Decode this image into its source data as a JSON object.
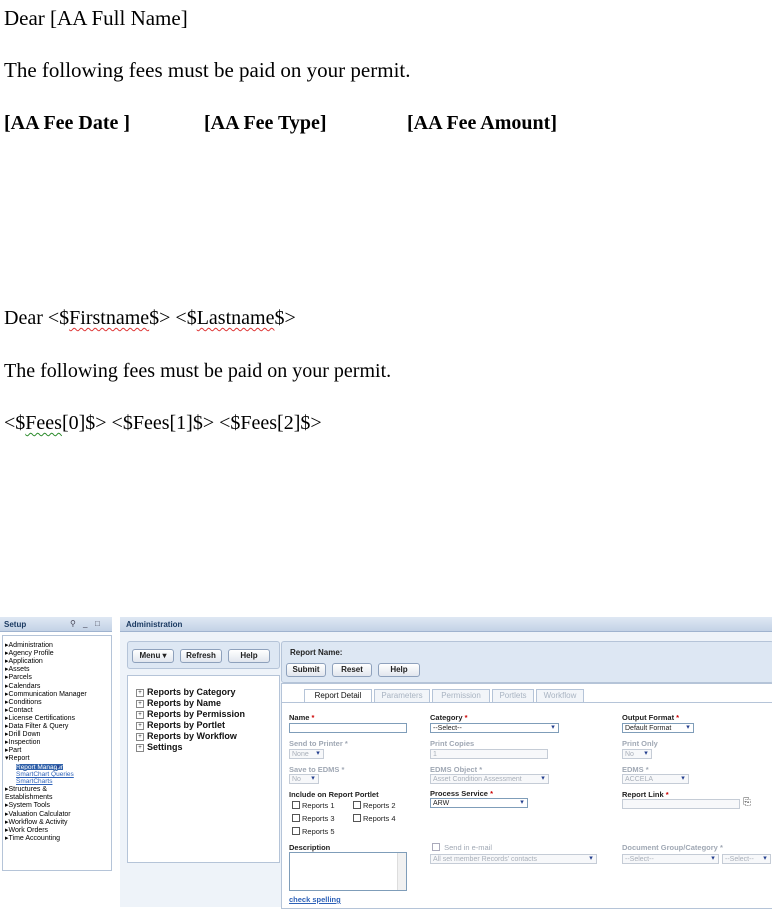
{
  "letter_template_1": {
    "salutation": "Dear [AA Full Name]",
    "body": "The following fees must be paid on your permit.",
    "fields": [
      "[AA Fee Date ]",
      "[AA Fee Type]",
      "[AA Fee Amount]"
    ]
  },
  "letter_template_2": {
    "salutation_prefix": "Dear <$",
    "firstname": "Firstname",
    "middle": "$> <$",
    "lastname": "Lastname",
    "salutation_suffix": "$>",
    "body": "The following fees must be paid on your permit.",
    "fees_prefix": "<$",
    "fees_word": "Fees",
    "fees_rest": "[0]$>  <$Fees[1]$>  <$Fees[2]$>"
  },
  "app": {
    "left_panel": {
      "title": "Setup",
      "icons": [
        "pin-icon",
        "minimize-icon",
        "maximize-icon"
      ],
      "nav_items": [
        "▸Administration",
        "▸Agency Profile",
        "▸Application",
        "▸Assets",
        "▸Parcels",
        "▸Calendars",
        "▸Communication Manager",
        "▸Conditions",
        "▸Contact",
        "▸License Certifications",
        "▸Data Filter & Query",
        "▸Drill Down",
        "▸Inspection",
        "▸Part",
        "▾Report"
      ],
      "report_subitems": [
        "Report Manager",
        "SmartChart Queries",
        "SmartCharts"
      ],
      "nav_items_after": [
        "▸Structures &",
        "Establishments",
        "▸System Tools",
        "▸Valuation Calculator",
        "▸Workflow & Activity",
        "▸Work Orders",
        "▸Time Accounting"
      ]
    },
    "right_panel": {
      "title": "Administration",
      "toolbar": {
        "menu": "Menu ▾",
        "refresh": "Refresh",
        "help": "Help"
      },
      "tree": [
        "Reports by Category",
        "Reports by Name",
        "Reports by Permission",
        "Reports by Portlet",
        "Reports by Workflow",
        "Settings"
      ],
      "report_name_label": "Report Name:",
      "actions": {
        "submit": "Submit",
        "reset": "Reset",
        "help": "Help"
      },
      "tabs": [
        "Report Detail",
        "Parameters",
        "Permission",
        "Portlets",
        "Workflow"
      ],
      "form": {
        "name_label": "Name",
        "category_label": "Category",
        "category_value": "--Select--",
        "output_format_label": "Output Format",
        "output_format_value": "Default Format",
        "send_to_printer_label": "Send to Printer",
        "send_to_printer_value": "None",
        "print_copies_label": "Print Copies",
        "print_copies_value": "1",
        "print_only_label": "Print Only",
        "print_only_value": "No",
        "save_to_edms_label": "Save to EDMS",
        "save_to_edms_value": "No",
        "edms_object_label": "EDMS Object",
        "edms_object_value": "Asset Condition Assessment",
        "edms_label": "EDMS",
        "edms_value": "ACCELA",
        "include_portlet_label": "Include on Report Portlet",
        "portlet_options": [
          "Reports 1",
          "Reports 2",
          "Reports 3",
          "Reports 4",
          "Reports 5"
        ],
        "process_service_label": "Process Service",
        "process_service_value": "ARW",
        "report_link_label": "Report Link",
        "description_label": "Description",
        "send_email_label": "Send in e-mail",
        "send_email_value": "All set member Records' contacts",
        "doc_group_label": "Document Group/Category",
        "doc_group_value": "--Select--",
        "doc_category_value": "--Select--",
        "check_spelling": "check spelling",
        "required_mark": "*"
      }
    }
  }
}
